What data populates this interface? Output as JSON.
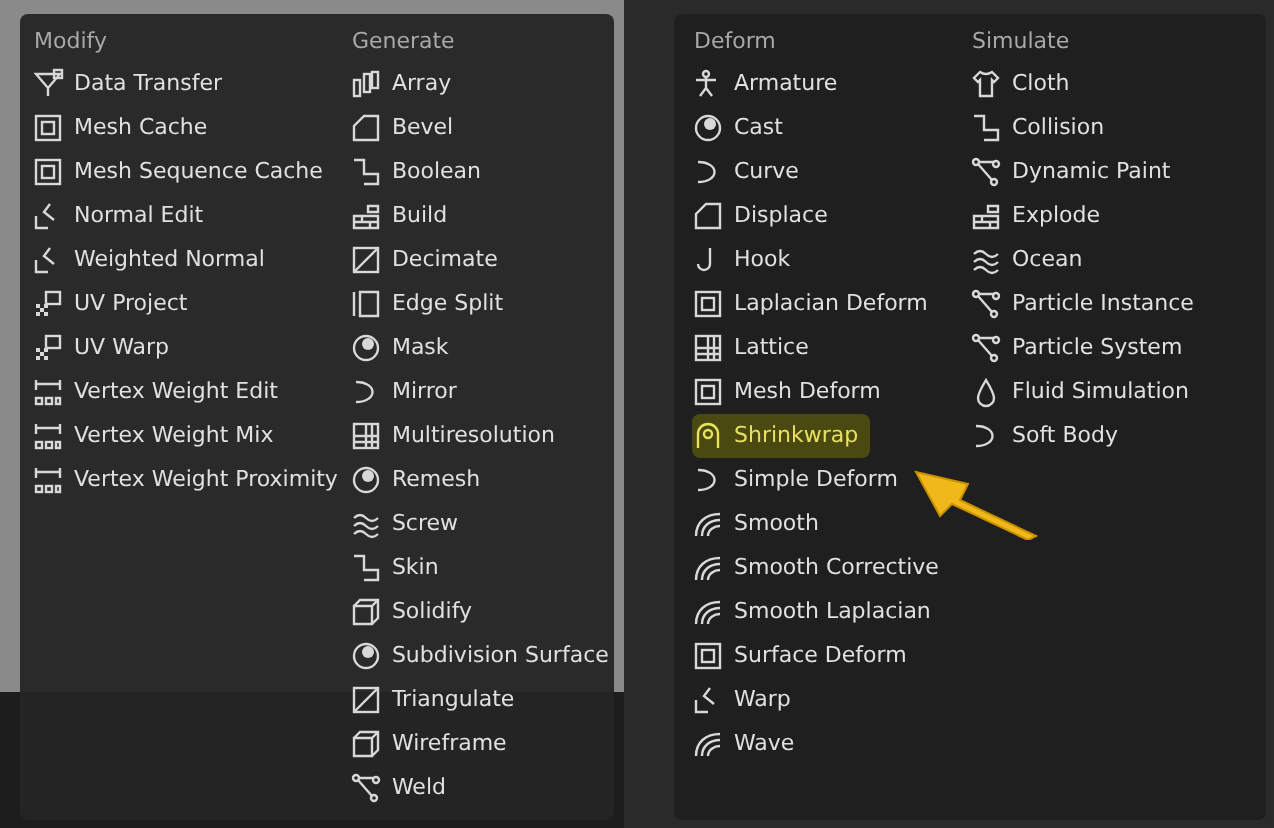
{
  "menus": [
    {
      "columns": [
        {
          "heading": "Modify",
          "items": [
            {
              "label": "Data Transfer",
              "selected": false
            },
            {
              "label": "Mesh Cache",
              "selected": false
            },
            {
              "label": "Mesh Sequence Cache",
              "selected": false
            },
            {
              "label": "Normal Edit",
              "selected": false
            },
            {
              "label": "Weighted Normal",
              "selected": false
            },
            {
              "label": "UV Project",
              "selected": false
            },
            {
              "label": "UV Warp",
              "selected": false
            },
            {
              "label": "Vertex Weight Edit",
              "selected": false
            },
            {
              "label": "Vertex Weight Mix",
              "selected": false
            },
            {
              "label": "Vertex Weight Proximity",
              "selected": false
            }
          ]
        },
        {
          "heading": "Generate",
          "items": [
            {
              "label": "Array",
              "selected": false
            },
            {
              "label": "Bevel",
              "selected": false
            },
            {
              "label": "Boolean",
              "selected": false
            },
            {
              "label": "Build",
              "selected": false
            },
            {
              "label": "Decimate",
              "selected": false
            },
            {
              "label": "Edge Split",
              "selected": false
            },
            {
              "label": "Mask",
              "selected": false
            },
            {
              "label": "Mirror",
              "selected": false
            },
            {
              "label": "Multiresolution",
              "selected": false
            },
            {
              "label": "Remesh",
              "selected": false
            },
            {
              "label": "Screw",
              "selected": false
            },
            {
              "label": "Skin",
              "selected": false
            },
            {
              "label": "Solidify",
              "selected": false
            },
            {
              "label": "Subdivision Surface",
              "selected": false
            },
            {
              "label": "Triangulate",
              "selected": false
            },
            {
              "label": "Wireframe",
              "selected": false
            },
            {
              "label": "Weld",
              "selected": false
            }
          ]
        }
      ]
    },
    {
      "columns": [
        {
          "heading": "Deform",
          "items": [
            {
              "label": "Armature",
              "selected": false
            },
            {
              "label": "Cast",
              "selected": false
            },
            {
              "label": "Curve",
              "selected": false
            },
            {
              "label": "Displace",
              "selected": false
            },
            {
              "label": "Hook",
              "selected": false
            },
            {
              "label": "Laplacian Deform",
              "selected": false
            },
            {
              "label": "Lattice",
              "selected": false
            },
            {
              "label": "Mesh Deform",
              "selected": false
            },
            {
              "label": "Shrinkwrap",
              "selected": true
            },
            {
              "label": "Simple Deform",
              "selected": false
            },
            {
              "label": "Smooth",
              "selected": false
            },
            {
              "label": "Smooth Corrective",
              "selected": false
            },
            {
              "label": "Smooth Laplacian",
              "selected": false
            },
            {
              "label": "Surface Deform",
              "selected": false
            },
            {
              "label": "Warp",
              "selected": false
            },
            {
              "label": "Wave",
              "selected": false
            }
          ]
        },
        {
          "heading": "Simulate",
          "items": [
            {
              "label": "Cloth",
              "selected": false
            },
            {
              "label": "Collision",
              "selected": false
            },
            {
              "label": "Dynamic Paint",
              "selected": false
            },
            {
              "label": "Explode",
              "selected": false
            },
            {
              "label": "Ocean",
              "selected": false
            },
            {
              "label": "Particle Instance",
              "selected": false
            },
            {
              "label": "Particle System",
              "selected": false
            },
            {
              "label": "Fluid Simulation",
              "selected": false
            },
            {
              "label": "Soft Body",
              "selected": false
            }
          ]
        }
      ]
    }
  ]
}
